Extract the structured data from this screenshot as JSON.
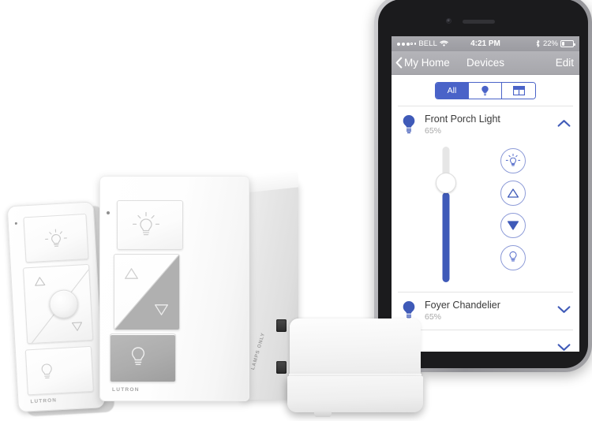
{
  "phone": {
    "status_bar": {
      "carrier": "BELL",
      "signal_dots_filled": 3,
      "signal_dots_total": 5,
      "wifi_icon": "wifi-icon",
      "time": "4:21 PM",
      "bluetooth_icon": "bluetooth-icon",
      "battery_percent": "22%",
      "battery_level": 22
    },
    "nav_bar": {
      "back_icon": "chevron-left-icon",
      "back_label": "My Home",
      "title": "Devices",
      "edit_label": "Edit"
    },
    "segmented_control": {
      "options": [
        {
          "label": "All",
          "icon": "",
          "selected": true
        },
        {
          "label": "",
          "icon": "bulb-icon",
          "selected": false
        },
        {
          "label": "",
          "icon": "shades-icon",
          "selected": false
        }
      ]
    },
    "devices": [
      {
        "name": "Front Porch Light",
        "level": "65%",
        "icon": "bulb-filled-icon",
        "expanded": true,
        "chevron": "chevron-up-icon",
        "slider": {
          "value": 65,
          "fill_color": "#3f5ab8",
          "track_color": "#e6e6e6"
        },
        "buttons": [
          {
            "icon": "bulb-bright-icon",
            "name": "full-on-button"
          },
          {
            "icon": "triangle-up-icon",
            "name": "raise-button"
          },
          {
            "icon": "triangle-down-icon",
            "name": "lower-button"
          },
          {
            "icon": "bulb-dim-icon",
            "name": "full-off-button"
          }
        ]
      },
      {
        "name": "Foyer Chandelier",
        "level": "65%",
        "icon": "bulb-filled-icon",
        "expanded": false,
        "chevron": "chevron-down-icon"
      },
      {
        "name": "",
        "level": "",
        "icon": "bulb-filled-icon",
        "expanded": false,
        "chevron": "chevron-down-icon"
      }
    ]
  },
  "hardware": {
    "pico_remote": {
      "brand": "LUTRON",
      "buttons": [
        {
          "name": "on-button",
          "icon": "bulb-bright-icon"
        },
        {
          "name": "dim-rocker",
          "icon": "triangle-up-icon, triangle-down-icon"
        },
        {
          "name": "favorite-button",
          "icon": "round-knob"
        },
        {
          "name": "off-button",
          "icon": "bulb-dim-icon"
        }
      ]
    },
    "plug_in_dimmer": {
      "brand": "LUTRON",
      "side_label": "LAMPS ONLY",
      "buttons": [
        {
          "name": "on-button",
          "icon": "bulb-bright-icon"
        },
        {
          "name": "dim-rocker",
          "icon": "triangle-up-icon, triangle-down-icon"
        },
        {
          "name": "off-button",
          "icon": "bulb-dim-icon"
        }
      ]
    },
    "smart_bridge": {
      "name": "smart-bridge-hub"
    }
  },
  "colors": {
    "accent_blue": "#4a63c8",
    "slider_blue": "#3f5ab8",
    "icon_outline_blue": "#8e9cd8",
    "nav_gray": "#a7a7ac",
    "text_dark": "#3a3a3a",
    "text_muted": "#a8a8a8"
  }
}
